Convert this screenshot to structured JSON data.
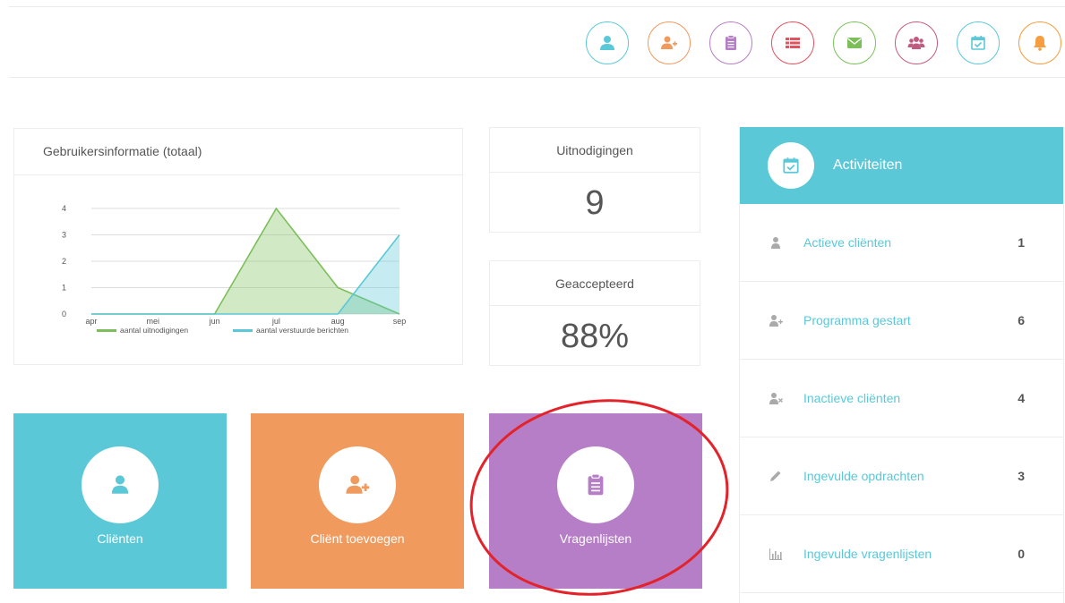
{
  "colors": {
    "teal": "#5bc8d8",
    "orange": "#f09a5e",
    "purple": "#b57ec6",
    "red": "#e0525e",
    "green": "#7cbf5a",
    "magenta": "#c05a80",
    "bell": "#f59d3f",
    "circle_annotation": "#e4222a"
  },
  "toolbar": {
    "buttons": [
      {
        "icon": "user-icon",
        "color": "#5bc8d8"
      },
      {
        "icon": "user-plus-icon",
        "color": "#f09a5e"
      },
      {
        "icon": "clipboard-icon",
        "color": "#b57ec6"
      },
      {
        "icon": "list-icon",
        "color": "#e0525e"
      },
      {
        "icon": "envelope-icon",
        "color": "#7cbf5a"
      },
      {
        "icon": "users-icon",
        "color": "#c05a80"
      },
      {
        "icon": "calendar-check-icon",
        "color": "#5bc8d8"
      },
      {
        "icon": "bell-icon",
        "color": "#f59d3f"
      }
    ]
  },
  "chart_card": {
    "title": "Gebruikersinformatie (totaal)"
  },
  "chart_data": {
    "type": "area",
    "categories": [
      "apr",
      "mei",
      "jun",
      "jul",
      "aug",
      "sep"
    ],
    "series": [
      {
        "name": "aantal uitnodigingen",
        "values": [
          0,
          0,
          0,
          4,
          1,
          0
        ],
        "color": "#7cbf5a"
      },
      {
        "name": "aantal verstuurde berichten",
        "values": [
          0,
          0,
          0,
          0,
          0,
          3
        ],
        "color": "#5bc8d8"
      }
    ],
    "yticks": [
      0,
      1,
      2,
      3,
      4
    ],
    "ylim": [
      0,
      4
    ],
    "grid": true,
    "legend": "bottom"
  },
  "stats": {
    "invitations": {
      "label": "Uitnodigingen",
      "value": "9"
    },
    "accepted": {
      "label": "Geaccepteerd",
      "value": "88%"
    }
  },
  "tiles": [
    {
      "label": "Cliënten",
      "icon": "user-icon",
      "color": "#5bc8d8"
    },
    {
      "label": "Cliënt toevoegen",
      "icon": "user-plus-icon",
      "color": "#f09a5e"
    },
    {
      "label": "Vragenlijsten",
      "icon": "clipboard-icon",
      "color": "#b57ec6"
    }
  ],
  "activities": {
    "title": "Activiteiten",
    "items": [
      {
        "label": "Actieve cliënten",
        "count": "1",
        "icon": "user-icon"
      },
      {
        "label": "Programma gestart",
        "count": "6",
        "icon": "user-plus-icon"
      },
      {
        "label": "Inactieve cliënten",
        "count": "4",
        "icon": "user-x-icon"
      },
      {
        "label": "Ingevulde opdrachten",
        "count": "3",
        "icon": "pencil-icon"
      },
      {
        "label": "Ingevulde vragenlijsten",
        "count": "0",
        "icon": "bar-chart-icon"
      }
    ]
  }
}
